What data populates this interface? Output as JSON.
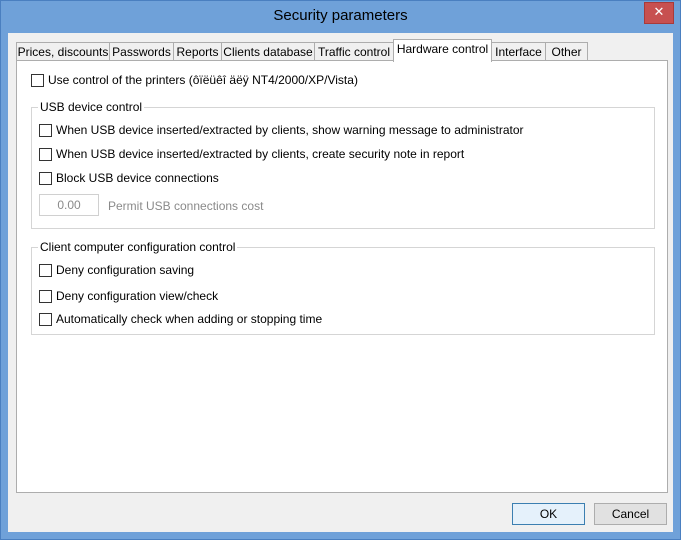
{
  "window": {
    "title": "Security parameters",
    "close_glyph": "✕"
  },
  "tabs": [
    {
      "label": "Prices, discounts"
    },
    {
      "label": "Passwords"
    },
    {
      "label": "Reports"
    },
    {
      "label": "Clients database"
    },
    {
      "label": "Traffic control"
    },
    {
      "label": "Hardware control"
    },
    {
      "label": "Interface"
    },
    {
      "label": "Other"
    }
  ],
  "active_tab": "Hardware control",
  "printers": {
    "label": "Use control of the printers (ôïëüêî äëÿ NT4/2000/XP/Vista)",
    "checked": false
  },
  "usb_group": {
    "legend": "USB device control",
    "items": [
      {
        "label": "When USB device inserted/extracted by clients, show warning message to administrator",
        "checked": false
      },
      {
        "label": "When USB device inserted/extracted by clients, create security note in report",
        "checked": false
      },
      {
        "label": "Block USB device connections",
        "checked": false
      }
    ],
    "cost_value": "0.00",
    "cost_label": "Permit USB connections cost"
  },
  "config_group": {
    "legend": "Client computer configuration control",
    "items": [
      {
        "label": "Deny configuration saving",
        "checked": false
      },
      {
        "label": "Deny configuration view/check",
        "checked": false
      },
      {
        "label": "Automatically check when adding or stopping time",
        "checked": false
      }
    ]
  },
  "buttons": {
    "ok": "OK",
    "cancel": "Cancel"
  },
  "colors": {
    "titlebar": "#6fa1d9",
    "close": "#c75050"
  }
}
